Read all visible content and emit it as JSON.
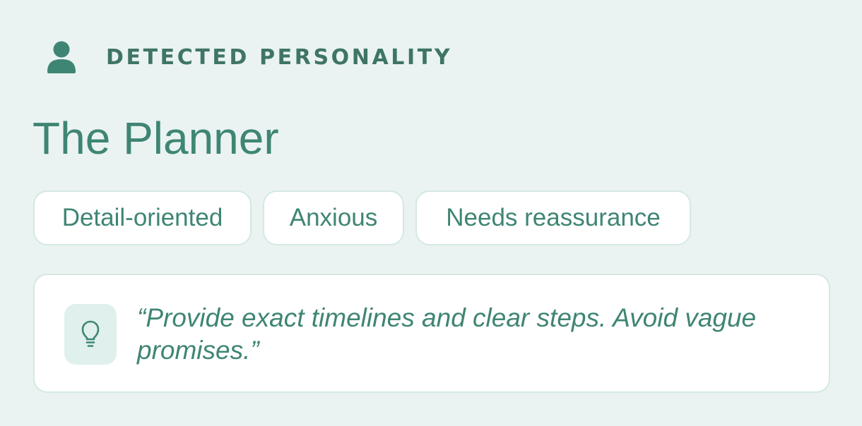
{
  "header": {
    "icon": "person-icon",
    "title": "DETECTED PERSONALITY"
  },
  "personality": {
    "name": "The Planner",
    "tags": [
      {
        "label": "Detail-oriented"
      },
      {
        "label": "Anxious"
      },
      {
        "label": "Needs reassurance"
      }
    ]
  },
  "tip": {
    "icon": "lightbulb-icon",
    "text": "“Provide exact timelines and clear steps. Avoid vague promises.”"
  },
  "colors": {
    "background": "#eaf3f2",
    "accent": "#3f8574",
    "border": "#d4e8e4",
    "icon_bg": "#dff0ed",
    "surface": "#ffffff"
  }
}
